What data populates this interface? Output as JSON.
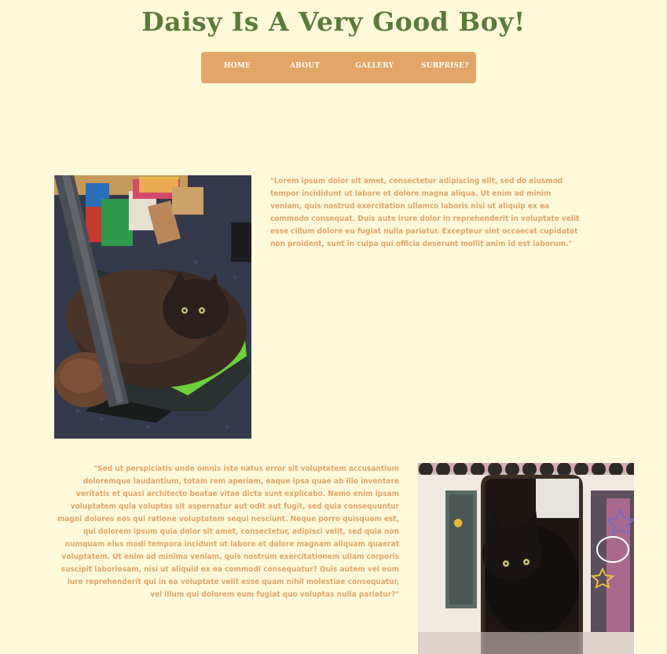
{
  "header": {
    "title": "Daisy Is A Very Good Boy!"
  },
  "nav": {
    "items": [
      {
        "label": "HOME"
      },
      {
        "label": "ABOUT"
      },
      {
        "label": "GALLERY"
      },
      {
        "label": "SURPRISE?"
      }
    ]
  },
  "sections": [
    {
      "image_alt": "cat lying on a bag under a desk",
      "text": "\"Lorem ipsum dolor sit amet, consectetur adipiscing elit, sed do eiusmod tempor incididunt ut labore et dolore magna aliqua. Ut enim ad minim veniam, quis nostrud exercitation ullamco laboris nisi ut aliquip ex ea commodo consequat. Duis aute irure dolor in reprehenderit in voluptate velit esse cillum dolore eu fugiat nulla pariatur. Excepteur sint occaecat cupidatat non proident, sunt in culpa qui officia deserunt mollit anim id est laborum.\""
    },
    {
      "image_alt": "black cat peeking out of a cardboard cat house",
      "text": "\"Sed ut perspiciatis unde omnis iste natus error sit voluptatem accusantium doloremque laudantium, totam rem aperiam, eaque ipsa quae ab illo inventore veritatis et quasi architecto beatae vitae dicta sunt explicabo. Nemo enim ipsam voluptatem quia voluptas sit aspernatur aut odit aut fugit, sed quia consequuntur magni dolores eos qui ratione voluptatem sequi nesciunt. Neque porro quisquam est, qui dolorem ipsum quia dolor sit amet, consectetur, adipisci velit, sed quia non numquam eius modi tempora incidunt ut labore et dolore magnam aliquam quaerat voluptatem. Ut enim ad minima veniam, quis nostrum exercitationem ullam corporis suscipit laboriosam, nisi ut aliquid ex ea commodi consequatur? Quis autem vel eum iure reprehenderit qui in ea voluptate velit esse quam nihil molestiae consequatur, vel illum qui dolorem eum fugiat quo voluptas nulla pariatur?\""
    }
  ],
  "colors": {
    "background": "#fefad9",
    "title": "#5c7a3a",
    "nav_bg": "#e3a568",
    "nav_text": "#ffffff",
    "body_text": "#e3a568"
  }
}
